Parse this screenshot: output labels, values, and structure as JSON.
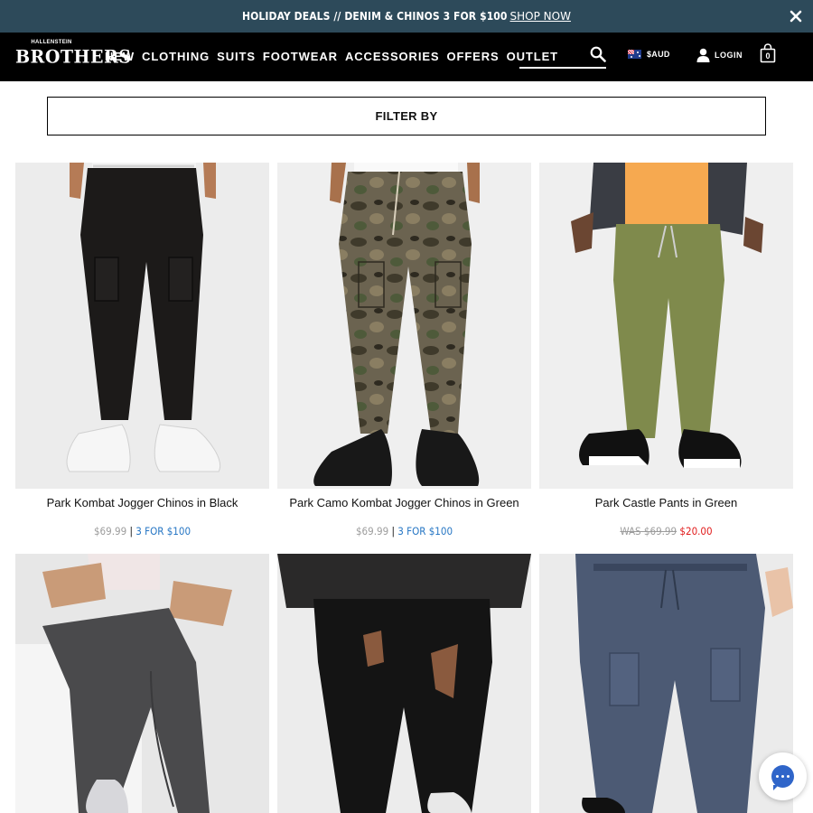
{
  "promo": {
    "text": "HOLIDAY DEALS // DENIM & CHINOS 3 FOR $100",
    "link_label": "SHOP NOW",
    "close_icon": "close-icon"
  },
  "header": {
    "logo_top": "HALLENSTEIN",
    "logo_main": "BROTHERS",
    "nav": [
      "NEW",
      "CLOTHING",
      "SUITS",
      "FOOTWEAR",
      "ACCESSORIES",
      "OFFERS",
      "OUTLET"
    ],
    "search": {
      "value": "",
      "placeholder": "",
      "icon": "search-icon"
    },
    "currency": "$AUD",
    "flag_icon": "australia-flag-icon",
    "login_label": "LOGIN",
    "user_icon": "user-icon",
    "cart_icon": "shopping-bag-icon",
    "cart_count": "0"
  },
  "filter": {
    "label": "FILTER BY"
  },
  "products": [
    {
      "name": "Park Kombat Jogger Chinos in Black",
      "price": "$69.99",
      "separator": "|",
      "deal": "3 FOR $100",
      "pant_color": "#1c1a19",
      "bg": "#ececec",
      "shoe": "white"
    },
    {
      "name": "Park Camo Kombat Jogger Chinos in Green",
      "price": "$69.99",
      "separator": "|",
      "deal": "3 FOR $100",
      "pant_color": "#5a5340",
      "bg": "#efefef",
      "shoe": "black"
    },
    {
      "name": "Park Castle Pants in Green",
      "was": "WAS $69.99",
      "sale": "$20.00",
      "pant_color": "#7f8a4c",
      "bg": "#efefef",
      "shoe": "checker"
    },
    {
      "name": "",
      "pant_color": "#4a4a4c",
      "bg": "#e7e7e7"
    },
    {
      "name": "",
      "pant_color": "#141414",
      "bg": "#ececec"
    },
    {
      "name": "",
      "pant_color": "#4c5a74",
      "bg": "#ebebeb"
    }
  ],
  "chat": {
    "icon": "chat-icon"
  }
}
